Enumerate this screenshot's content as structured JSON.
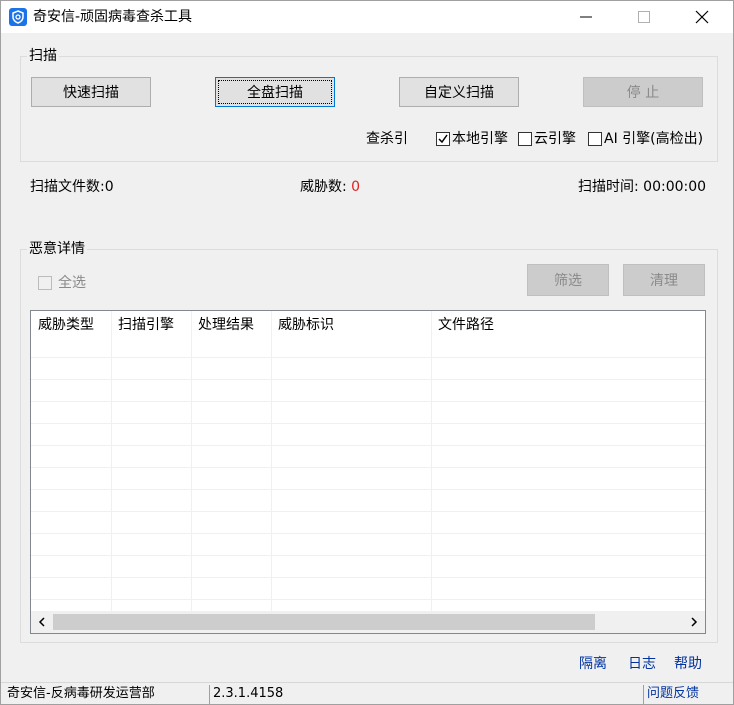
{
  "window": {
    "title": "奇安信-顽固病毒查杀工具",
    "accent": "#1a73e8"
  },
  "scan_group": {
    "legend": "扫描",
    "quick_scan": "快速扫描",
    "full_scan": "全盘扫描",
    "custom_scan": "自定义扫描",
    "stop": "停 止",
    "engine_label": "查杀引",
    "engines": [
      {
        "label": "本地引擎",
        "checked": true
      },
      {
        "label": "云引擎",
        "checked": false
      },
      {
        "label": "AI 引擎(高检出)",
        "checked": false
      }
    ]
  },
  "stats": {
    "files_label": "扫描文件数:",
    "files_value": "0",
    "threats_label": "威胁数: ",
    "threats_value": "0",
    "time_label": "扫描时间: ",
    "time_value": "00:00:00",
    "threat_color": "#e02020"
  },
  "details_group": {
    "legend": "恶意详情",
    "select_all": "全选",
    "filter": "筛选",
    "clean": "清理",
    "columns": [
      "威胁类型",
      "扫描引擎",
      "处理结果",
      "威胁标识",
      "文件路径"
    ]
  },
  "links": {
    "quarantine": "隔离",
    "log": "日志",
    "help": "帮助"
  },
  "statusbar": {
    "org": "奇安信-反病毒研发运营部",
    "version": "2.3.1.4158",
    "feedback": "问题反馈"
  }
}
